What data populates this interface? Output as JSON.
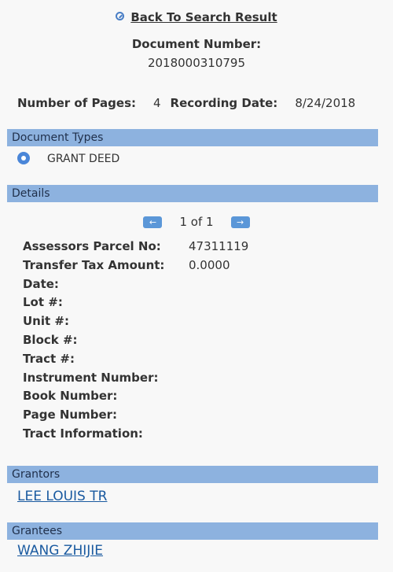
{
  "back_link": "Back To Search Result",
  "document_number_label": "Document Number:",
  "document_number": "2018000310795",
  "number_of_pages_label": "Number of Pages:",
  "number_of_pages": "4",
  "recording_date_label": "Recording Date:",
  "recording_date": "8/24/2018",
  "sections": {
    "document_types": "Document Types",
    "details": "Details",
    "grantors": "Grantors",
    "grantees": "Grantees"
  },
  "document_type": "GRANT DEED",
  "pager": {
    "prev_icon": "arrow-left-icon",
    "next_icon": "arrow-right-icon",
    "text": "1 of 1"
  },
  "details": [
    {
      "label": "Assessors Parcel No:",
      "value": "47311119"
    },
    {
      "label": "Transfer Tax Amount:",
      "value": "0.0000"
    },
    {
      "label": "Date:",
      "value": ""
    },
    {
      "label": "Lot #:",
      "value": ""
    },
    {
      "label": "Unit #:",
      "value": ""
    },
    {
      "label": "Block #:",
      "value": ""
    },
    {
      "label": "Tract #:",
      "value": ""
    },
    {
      "label": "Instrument Number:",
      "value": ""
    },
    {
      "label": "Book Number:",
      "value": ""
    },
    {
      "label": "Page Number:",
      "value": ""
    },
    {
      "label": "Tract Information:",
      "value": ""
    }
  ],
  "grantor": "LEE LOUIS TR",
  "grantee": "WANG ZHIJIE",
  "colors": {
    "section_bar": "#8db2df",
    "accent": "#4a86d8",
    "link": "#1a5aa0"
  }
}
